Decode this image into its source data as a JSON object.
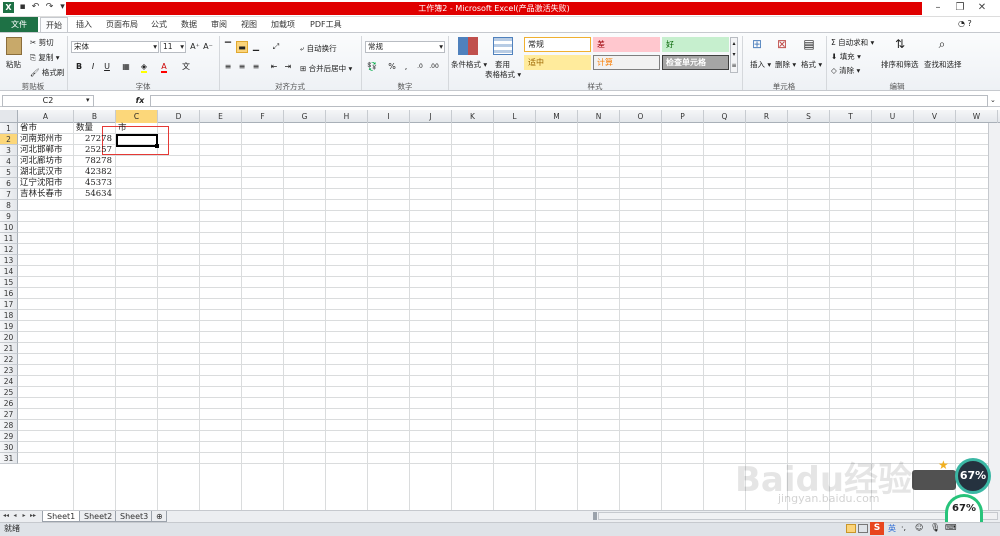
{
  "window": {
    "title": "工作簿2 - Microsoft Excel(产品激活失败)",
    "app_icon": "X"
  },
  "tabs": [
    "文件",
    "开始",
    "插入",
    "页面布局",
    "公式",
    "数据",
    "审阅",
    "视图",
    "加载项",
    "PDF工具"
  ],
  "ribbon": {
    "clipboard": {
      "paste": "粘贴",
      "cut": "剪切",
      "copy": "复制",
      "format_painter": "格式刷",
      "label": "剪贴板"
    },
    "font": {
      "name": "宋体",
      "size": "11",
      "label": "字体",
      "bold": "B",
      "italic": "I",
      "underline": "U"
    },
    "alignment": {
      "wrap": "自动换行",
      "merge": "合并后居中",
      "label": "对齐方式"
    },
    "number": {
      "format": "常规",
      "label": "数字",
      "percent": "%",
      "comma": ","
    },
    "styles": {
      "conditional": "条件格式",
      "table_line1": "套用",
      "table_line2": "表格格式",
      "label": "样式",
      "cells": [
        {
          "text": "常规",
          "bg": "#ffffff",
          "fg": "#222222",
          "border": "#f0b030"
        },
        {
          "text": "差",
          "bg": "#ffc7ce",
          "fg": "#9c0006",
          "border": "#ffc7ce"
        },
        {
          "text": "好",
          "bg": "#c6efce",
          "fg": "#006100",
          "border": "#c6efce"
        },
        {
          "text": "适中",
          "bg": "#ffeb9c",
          "fg": "#9c6500",
          "border": "#ffeb9c"
        },
        {
          "text": "计算",
          "bg": "#f2f2f2",
          "fg": "#fa7d00",
          "border": "#7f7f7f"
        },
        {
          "text": "检查单元格",
          "bg": "#a5a5a5",
          "fg": "#ffffff",
          "border": "#3f3f3f"
        }
      ]
    },
    "cells_group": {
      "insert": "插入",
      "delete": "删除",
      "format": "格式",
      "label": "单元格"
    },
    "editing": {
      "autosum": "自动求和",
      "fill": "填充",
      "clear": "清除",
      "sort": "排序和筛选",
      "find": "查找和选择",
      "label": "编辑"
    }
  },
  "formula_bar": {
    "name_box": "C2",
    "fx": "fx",
    "value": ""
  },
  "columns": [
    "A",
    "B",
    "C",
    "D",
    "E",
    "F",
    "G",
    "H",
    "I",
    "J",
    "K",
    "L",
    "M",
    "N",
    "O",
    "P",
    "Q",
    "R",
    "S",
    "T",
    "U",
    "V",
    "W"
  ],
  "selected_column": "C",
  "selected_row": 2,
  "row_count": 31,
  "cells": [
    {
      "row": 1,
      "col": "A",
      "value": "省市"
    },
    {
      "row": 1,
      "col": "B",
      "value": "数量"
    },
    {
      "row": 1,
      "col": "C",
      "value": "市"
    },
    {
      "row": 2,
      "col": "A",
      "value": "河南郑州市"
    },
    {
      "row": 2,
      "col": "B",
      "value": "27278"
    },
    {
      "row": 3,
      "col": "A",
      "value": "河北邯郸市"
    },
    {
      "row": 3,
      "col": "B",
      "value": "25257"
    },
    {
      "row": 4,
      "col": "A",
      "value": "河北廊坊市"
    },
    {
      "row": 4,
      "col": "B",
      "value": "78278"
    },
    {
      "row": 5,
      "col": "A",
      "value": "湖北武汉市"
    },
    {
      "row": 5,
      "col": "B",
      "value": "42382"
    },
    {
      "row": 6,
      "col": "A",
      "value": "辽宁沈阳市"
    },
    {
      "row": 6,
      "col": "B",
      "value": "45373"
    },
    {
      "row": 7,
      "col": "A",
      "value": "吉林长春市"
    },
    {
      "row": 7,
      "col": "B",
      "value": "54634"
    }
  ],
  "sheets": [
    "Sheet1",
    "Sheet2",
    "Sheet3"
  ],
  "active_sheet": "Sheet1",
  "status": {
    "ready": "就绪"
  },
  "overlay": {
    "watermark": "Baidu经验",
    "watermark_url": "jingyan.baidu.com",
    "badge1": "67%",
    "badge2": "67%"
  }
}
